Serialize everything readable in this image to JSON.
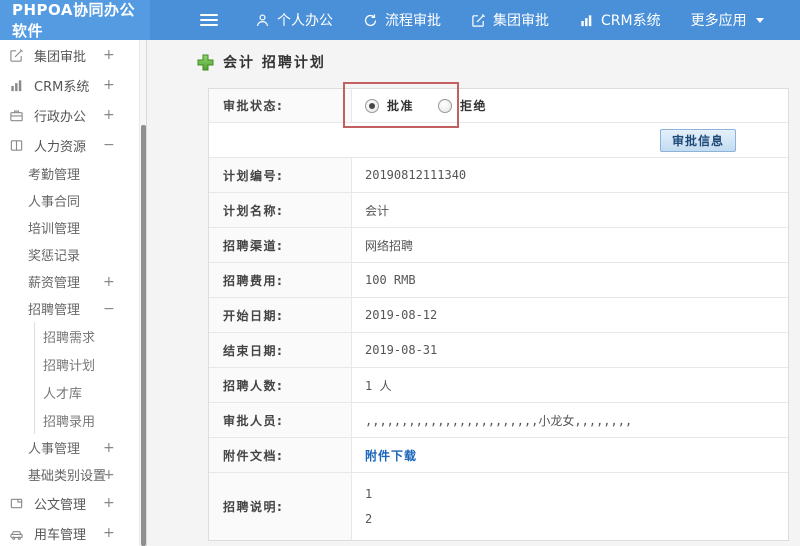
{
  "topbar": {
    "logo": "PHPOA协同办公软件",
    "nav": [
      {
        "label": "个人办公",
        "icon": "user-icon"
      },
      {
        "label": "流程审批",
        "icon": "process-icon"
      },
      {
        "label": "集团审批",
        "icon": "edit-icon"
      },
      {
        "label": "CRM系统",
        "icon": "bar-chart-icon"
      },
      {
        "label": "更多应用",
        "icon": "caret-down-icon"
      }
    ]
  },
  "sidebar": {
    "items": [
      {
        "label": "集团审批",
        "expand": "+",
        "icon": "edit-icon"
      },
      {
        "label": "CRM系统",
        "expand": "+",
        "icon": "bar-chart-icon"
      },
      {
        "label": "行政办公",
        "expand": "+",
        "icon": "briefcase-icon"
      },
      {
        "label": "人力资源",
        "expand": "−",
        "icon": "book-icon"
      },
      {
        "label": "考勤管理",
        "expand": ""
      },
      {
        "label": "人事合同",
        "expand": ""
      },
      {
        "label": "培训管理",
        "expand": ""
      },
      {
        "label": "奖惩记录",
        "expand": ""
      },
      {
        "label": "薪资管理",
        "expand": "+"
      },
      {
        "label": "招聘管理",
        "expand": "−"
      },
      {
        "label": "招聘需求",
        "expand": ""
      },
      {
        "label": "招聘计划",
        "expand": ""
      },
      {
        "label": "人才库",
        "expand": ""
      },
      {
        "label": "招聘录用",
        "expand": ""
      },
      {
        "label": "人事管理",
        "expand": "+"
      },
      {
        "label": "基础类别设置",
        "expand": "+"
      },
      {
        "label": "公文管理",
        "expand": "+",
        "icon": "document-icon"
      },
      {
        "label": "用车管理",
        "expand": "+",
        "icon": "car-icon"
      }
    ]
  },
  "main": {
    "title": "会计 招聘计划",
    "status_row": {
      "label": "审批状态:",
      "options": [
        {
          "label": "批准",
          "checked": true
        },
        {
          "label": "拒绝",
          "checked": false
        }
      ]
    },
    "approve_button": "审批信息",
    "rows": [
      {
        "label": "计划编号:",
        "value": "20190812111340"
      },
      {
        "label": "计划名称:",
        "value": "会计"
      },
      {
        "label": "招聘渠道:",
        "value": "网络招聘"
      },
      {
        "label": "招聘费用:",
        "value": "100 RMB"
      },
      {
        "label": "开始日期:",
        "value": "2019-08-12"
      },
      {
        "label": "结束日期:",
        "value": "2019-08-31"
      },
      {
        "label": "招聘人数:",
        "value": "1 人"
      },
      {
        "label": "审批人员:",
        "value": ",,,,,,,,,,,,,,,,,,,,,,,,小龙女,,,,,,,,"
      },
      {
        "label": "附件文档:",
        "value": "附件下载"
      },
      {
        "label": "招聘说明:",
        "lines": [
          "1",
          "2"
        ]
      }
    ]
  },
  "colors": {
    "topbar_blue": "#4a90d9",
    "highlight_red": "#c15f61",
    "link_blue": "#1a66b8",
    "plus_green": "#6abf4b"
  }
}
